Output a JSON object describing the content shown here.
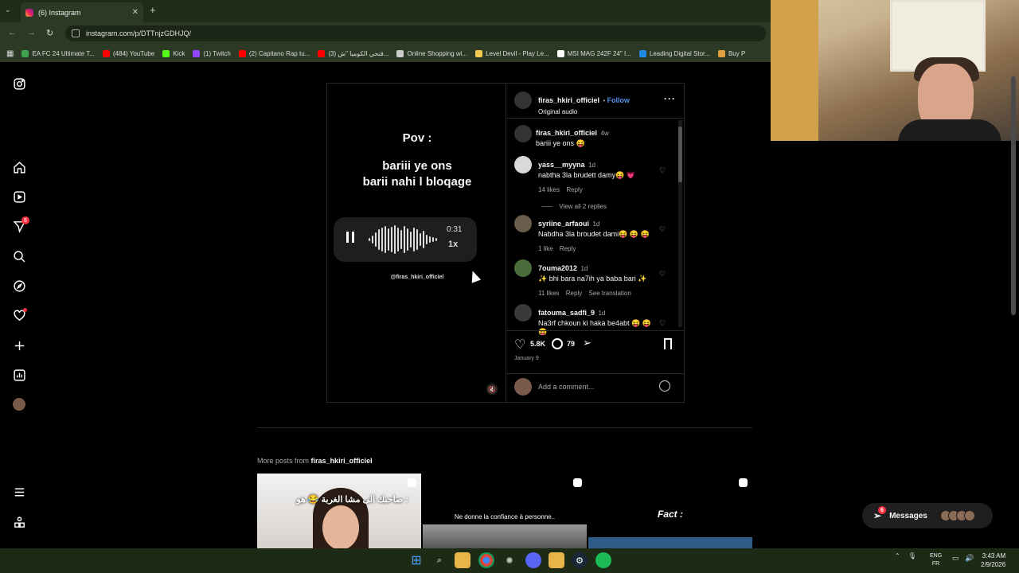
{
  "browser": {
    "tab_title": "(6) Instagram",
    "url": "instagram.com/p/DTTnjzGDHJQ/",
    "bookmarks": [
      {
        "label": "EA FC 24 Ultimate T...",
        "color": "#3fa34d"
      },
      {
        "label": "(484) YouTube",
        "color": "#ff0000"
      },
      {
        "label": "Kick",
        "color": "#53fc18"
      },
      {
        "label": "(1) Twitch",
        "color": "#9146ff"
      },
      {
        "label": "(2) Capitano Rap tu...",
        "color": "#ff0000"
      },
      {
        "label": "(3) فتحي الكوميا \"ش...",
        "color": "#ff0000"
      },
      {
        "label": "Online Shopping wi...",
        "color": "#cccccc"
      },
      {
        "label": "Level Devil - Play Le...",
        "color": "#f2c94c"
      },
      {
        "label": "MSI MAG 242F 24\" I...",
        "color": "#ffffff"
      },
      {
        "label": "Leading Digital Stor...",
        "color": "#1e88e5"
      },
      {
        "label": "Buy P",
        "color": "#e0a040"
      }
    ]
  },
  "sidebar": {
    "notifications_badge": "6"
  },
  "post": {
    "author": "firas_hkiri_officiel",
    "follow": "Follow",
    "audio": "Original audio",
    "media": {
      "pov": "Pov :",
      "line1": "bariii ye ons",
      "line2": "barii nahi l bloqage",
      "voice_time": "0:31",
      "voice_speed": "1x",
      "watermark": "@firas_hkiri_officiel"
    },
    "caption": {
      "user": "firas_hkiri_officiel",
      "time": "4w",
      "text": "bariii ye ons 😝"
    },
    "comments": [
      {
        "user": "yass__myyna",
        "time": "1d",
        "text": "nabtha 3la brudett damy😝 💗",
        "likes": "14 likes",
        "reply": "Reply",
        "view_replies": "View all 2 replies"
      },
      {
        "user": "syriine_arfaoui",
        "time": "1d",
        "text": "Nabdha 3la broudet dami😝 😝 😝",
        "likes": "1 like",
        "reply": "Reply"
      },
      {
        "user": "7ouma2012",
        "time": "1d",
        "text": "✨ bhi bara na7ih ya baba bari ✨",
        "likes": "11 likes",
        "reply": "Reply",
        "translate": "See translation"
      },
      {
        "user": "fatouma_sadfi_9",
        "time": "1d",
        "text": "Na3rf chkoun ki haka be4abt 😝 😝 😝",
        "likes": "",
        "reply": ""
      }
    ],
    "like_count": "5.8K",
    "comment_count": "79",
    "date": "January 9",
    "add_comment_placeholder": "Add a comment..."
  },
  "more_posts": {
    "prefix": "More posts from",
    "user": "firas_hkiri_officiel",
    "thumbs": [
      {
        "text": "صاحبك الى مشا الغربة 😂 هو :"
      },
      {
        "text": "Ne donne la confiance à personne.."
      },
      {
        "text": "Fact :"
      }
    ]
  },
  "messages": {
    "label": "Messages",
    "badge": "6"
  },
  "taskbar": {
    "lang_top": "ENG",
    "lang_bottom": "FR",
    "time": "3:43 AM",
    "date": "2/9/2026"
  }
}
